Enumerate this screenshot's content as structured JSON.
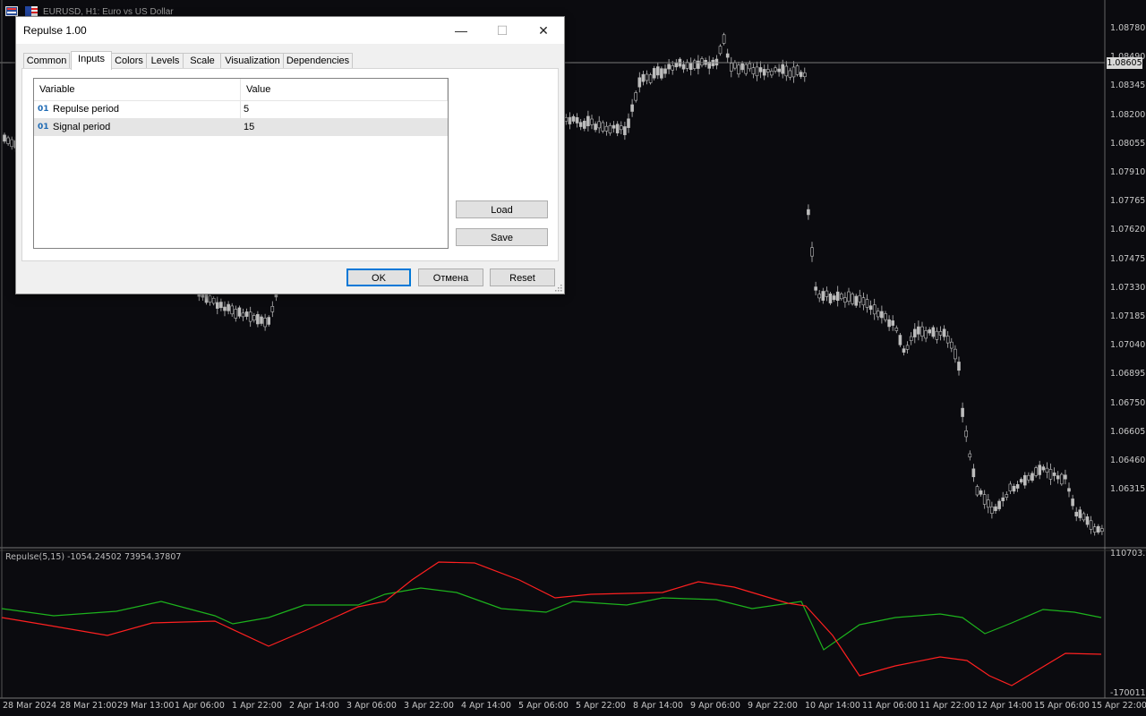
{
  "chart": {
    "title": "EURUSD, H1:  Euro vs US Dollar",
    "price_labels": [
      "1.08780",
      "1.08490",
      "1.08345",
      "1.08200",
      "1.08055",
      "1.07910",
      "1.07765",
      "1.07620",
      "1.07475",
      "1.07330",
      "1.07185",
      "1.07040",
      "1.06895",
      "1.06750",
      "1.06605",
      "1.06460",
      "1.06315"
    ],
    "current_price": "1.08605",
    "time_labels": [
      "28 Mar 2024",
      "28 Mar 21:00",
      "29 Mar 13:00",
      "1 Apr 06:00",
      "1 Apr 22:00",
      "2 Apr 14:00",
      "3 Apr 06:00",
      "3 Apr 22:00",
      "4 Apr 14:00",
      "5 Apr 06:00",
      "5 Apr 22:00",
      "8 Apr 14:00",
      "9 Apr 06:00",
      "9 Apr 22:00",
      "10 Apr 14:00",
      "11 Apr 06:00",
      "11 Apr 22:00",
      "12 Apr 14:00",
      "15 Apr 06:00",
      "15 Apr 22:00"
    ],
    "colors": {
      "background": "#0b0b0f",
      "candle": "#bdbdbd",
      "grid_line": "#555555",
      "signal_line": "#ff2020",
      "repulse_line": "#1db31d"
    }
  },
  "indicator": {
    "title": "Repulse(5,15) -1054.24502 73954.37807",
    "max_label": "110703.14",
    "min_label": "-170011.21"
  },
  "dialog": {
    "title": "Repulse 1.00",
    "buttons": {
      "minimize": "—",
      "maximize": "☐",
      "close": "✕"
    },
    "tabs": [
      "Common",
      "Inputs",
      "Colors",
      "Levels",
      "Scale",
      "Visualization",
      "Dependencies"
    ],
    "active_tab": "Inputs",
    "grid": {
      "headers": {
        "variable": "Variable",
        "value": "Value"
      },
      "rows": [
        {
          "type": "01",
          "variable": "Repulse period",
          "value": "5"
        },
        {
          "type": "01",
          "variable": "Signal period",
          "value": "15"
        }
      ]
    },
    "load_label": "Load",
    "save_label": "Save",
    "ok_label": "OK",
    "cancel_label": "Отмена",
    "reset_label": "Reset"
  }
}
